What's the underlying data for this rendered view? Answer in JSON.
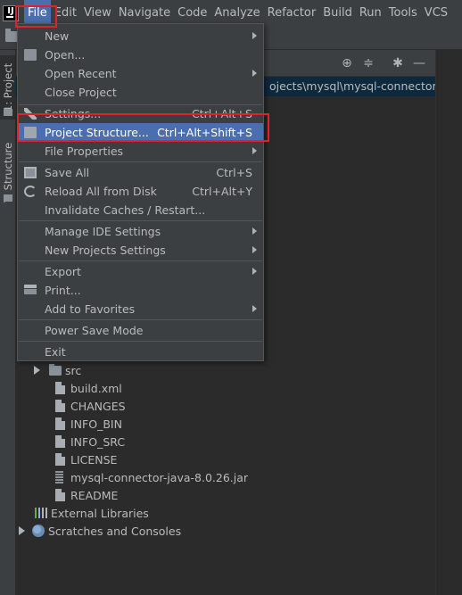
{
  "menubar": {
    "logo": "intellij-logo",
    "items": [
      "File",
      "Edit",
      "View",
      "Navigate",
      "Code",
      "Analyze",
      "Refactor",
      "Build",
      "Run",
      "Tools",
      "VCS"
    ],
    "active": "File"
  },
  "left_strip": {
    "project_tab": "1: Project",
    "structure_tab": "7: Structure"
  },
  "panel": {
    "root_path": "ojects\\mysql\\mysql-connector-java"
  },
  "file_menu": {
    "items": [
      {
        "label": "New",
        "shortcut": "",
        "submenu": true
      },
      {
        "label": "Open...",
        "shortcut": "",
        "submenu": false,
        "icon": "folder-open-icon"
      },
      {
        "label": "Open Recent",
        "shortcut": "",
        "submenu": true
      },
      {
        "label": "Close Project",
        "shortcut": "",
        "submenu": false
      },
      {
        "label": "Settings...",
        "shortcut": "Ctrl+Alt+S",
        "submenu": false,
        "icon": "wrench-icon"
      },
      {
        "label": "Project Structure...",
        "shortcut": "Ctrl+Alt+Shift+S",
        "submenu": false,
        "icon": "project-structure-icon",
        "selected": true
      },
      {
        "label": "File Properties",
        "shortcut": "",
        "submenu": true
      },
      {
        "label": "Save All",
        "shortcut": "Ctrl+S",
        "submenu": false,
        "icon": "save-icon"
      },
      {
        "label": "Reload All from Disk",
        "shortcut": "Ctrl+Alt+Y",
        "submenu": false,
        "icon": "reload-icon"
      },
      {
        "label": "Invalidate Caches / Restart...",
        "shortcut": "",
        "submenu": false
      },
      {
        "label": "Manage IDE Settings",
        "shortcut": "",
        "submenu": true
      },
      {
        "label": "New Projects Settings",
        "shortcut": "",
        "submenu": true
      },
      {
        "label": "Export",
        "shortcut": "",
        "submenu": true
      },
      {
        "label": "Print...",
        "shortcut": "",
        "submenu": false,
        "icon": "print-icon"
      },
      {
        "label": "Add to Favorites",
        "shortcut": "",
        "submenu": true
      },
      {
        "label": "Power Save Mode",
        "shortcut": "",
        "submenu": false
      },
      {
        "label": "Exit",
        "shortcut": "",
        "submenu": false
      }
    ]
  },
  "tree": {
    "src": "src",
    "files": [
      "build.xml",
      "CHANGES",
      "INFO_BIN",
      "INFO_SRC",
      "LICENSE",
      "mysql-connector-java-8.0.26.jar",
      "README"
    ],
    "external_libraries": "External Libraries",
    "scratches": "Scratches and Consoles"
  },
  "colors": {
    "accent": "#4b6eaf",
    "highlight_annotation": "#e0232b",
    "background": "#2b2b2b"
  }
}
